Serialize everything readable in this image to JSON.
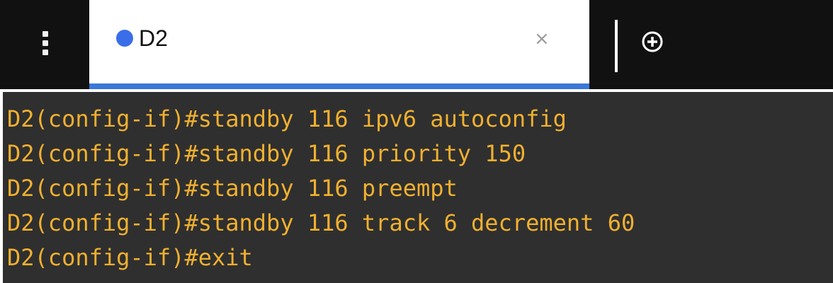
{
  "tab": {
    "title": "D2",
    "close_glyph": "×",
    "status_color": "#3a6ee8"
  },
  "icons": {
    "menu": "kebab-menu-icon",
    "new_tab": "plus-circle-icon",
    "close": "close-icon"
  },
  "colors": {
    "tabbar_bg": "#111111",
    "tab_accent": "#3a78d8",
    "terminal_bg": "#2f2f2f",
    "terminal_text": "#f0b030"
  },
  "terminal": {
    "lines": [
      "D2(config-if)#standby 116 ipv6 autoconfig",
      "D2(config-if)#standby 116 priority 150",
      "D2(config-if)#standby 116 preempt",
      "D2(config-if)#standby 116 track 6 decrement 60",
      "D2(config-if)#exit"
    ]
  }
}
